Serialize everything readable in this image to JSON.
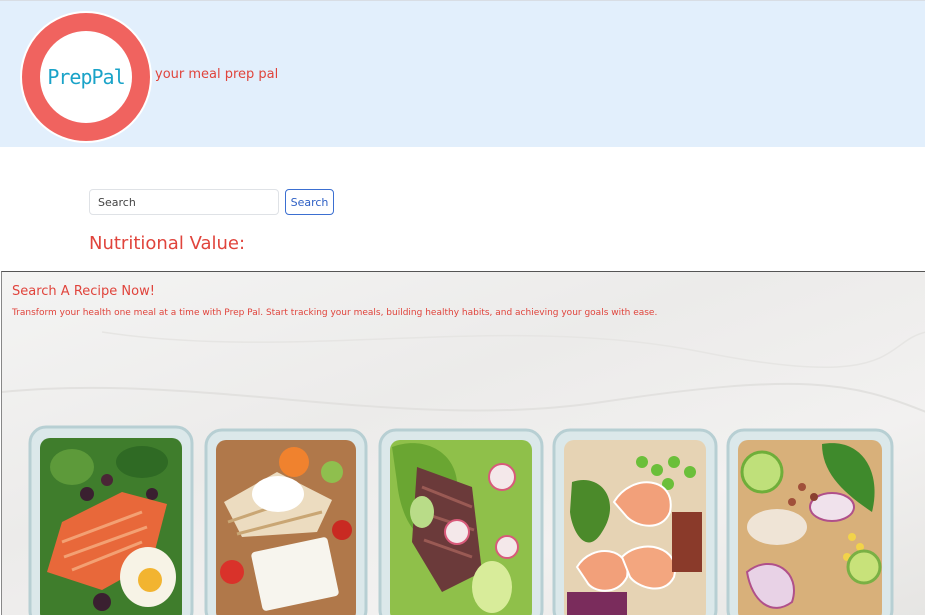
{
  "header": {
    "logo_text": "PrepPal",
    "tagline": "your meal prep pal"
  },
  "search": {
    "placeholder": "Search",
    "button_label": "Search"
  },
  "nutrition": {
    "heading": "Nutritional Value:"
  },
  "hero": {
    "title": "Search A Recipe Now!",
    "text": "Transform your health one meal at a time with Prep Pal. Start tracking your meals, building healthy habits, and achieving your goals with ease.",
    "image_alt": "meal prep containers"
  },
  "colors": {
    "header_bg": "#e2effc",
    "logo_ring": "#f0635f",
    "logo_text": "#1aa3c8",
    "accent_red": "#e0443c",
    "button_blue": "#3b6fd1"
  }
}
